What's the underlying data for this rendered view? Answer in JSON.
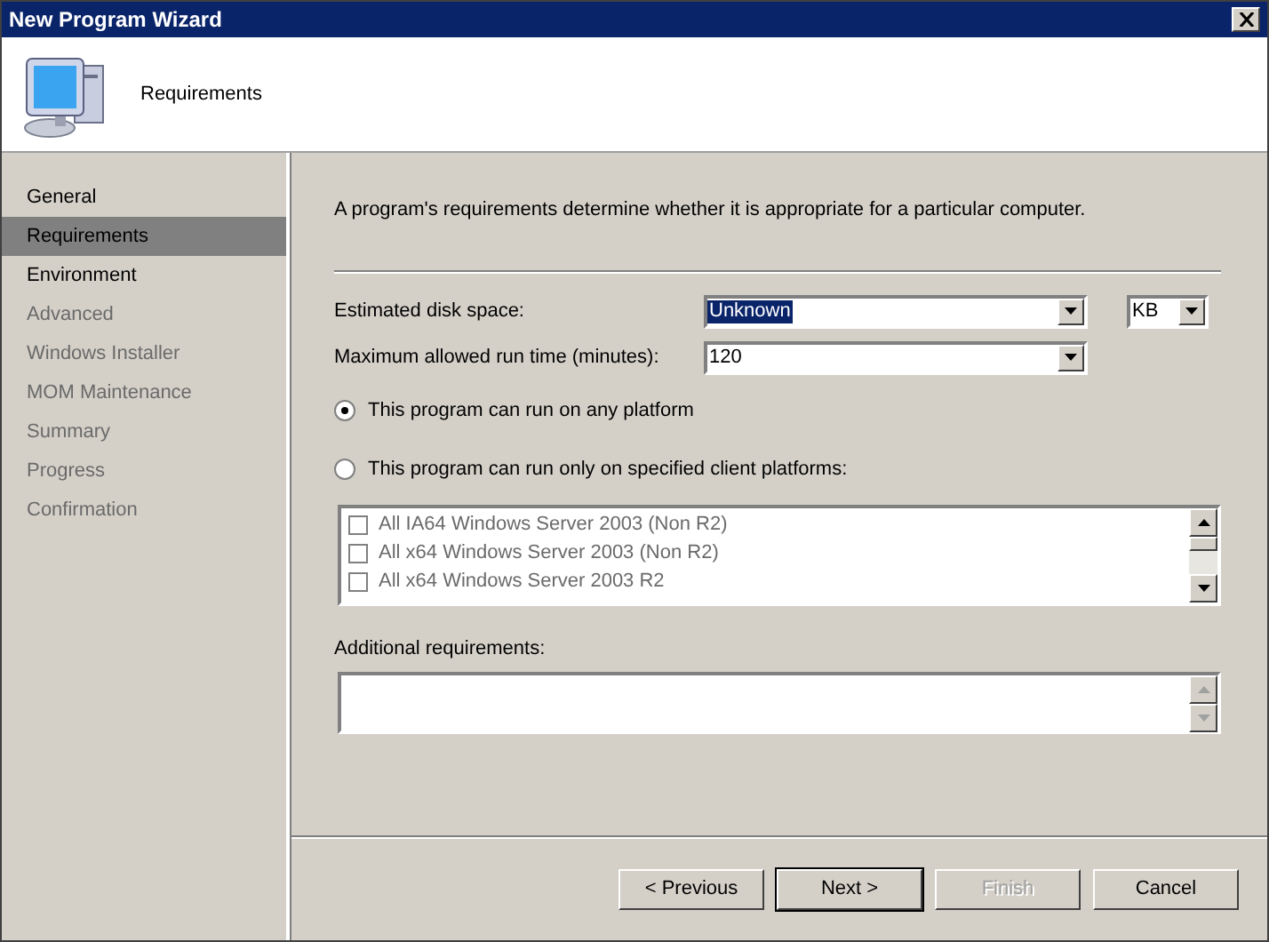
{
  "window": {
    "title": "New Program Wizard"
  },
  "header": {
    "title": "Requirements"
  },
  "sidebar": {
    "items": [
      {
        "label": "General",
        "selected": false,
        "disabled": false
      },
      {
        "label": "Requirements",
        "selected": true,
        "disabled": false
      },
      {
        "label": "Environment",
        "selected": false,
        "disabled": false
      },
      {
        "label": "Advanced",
        "selected": false,
        "disabled": true
      },
      {
        "label": "Windows Installer",
        "selected": false,
        "disabled": true
      },
      {
        "label": "MOM Maintenance",
        "selected": false,
        "disabled": true
      },
      {
        "label": "Summary",
        "selected": false,
        "disabled": true
      },
      {
        "label": "Progress",
        "selected": false,
        "disabled": true
      },
      {
        "label": "Confirmation",
        "selected": false,
        "disabled": true
      }
    ]
  },
  "description": "A program's requirements determine whether it is appropriate for a particular computer.",
  "disk_space": {
    "label": "Estimated disk space:",
    "value": "Unknown",
    "unit": "KB"
  },
  "run_time": {
    "label": "Maximum allowed run time (minutes):",
    "value": "120"
  },
  "platform_options": [
    {
      "label": "This program can run on any platform",
      "selected": true
    },
    {
      "label": "This program can run only on specified client platforms:",
      "selected": false
    }
  ],
  "platforms": {
    "disabled": true,
    "items": [
      {
        "label": "All IA64 Windows Server 2003 (Non R2)",
        "checked": false
      },
      {
        "label": "All x64 Windows Server 2003 (Non R2)",
        "checked": false
      },
      {
        "label": "All x64 Windows Server 2003 R2",
        "checked": false
      }
    ]
  },
  "additional": {
    "label": "Additional requirements:"
  },
  "buttons": [
    {
      "label": "< Previous",
      "disabled": false,
      "default": false
    },
    {
      "label": "Next >",
      "disabled": false,
      "default": true
    },
    {
      "label": "Finish",
      "disabled": true,
      "default": false
    },
    {
      "label": "Cancel",
      "disabled": false,
      "default": false
    }
  ]
}
